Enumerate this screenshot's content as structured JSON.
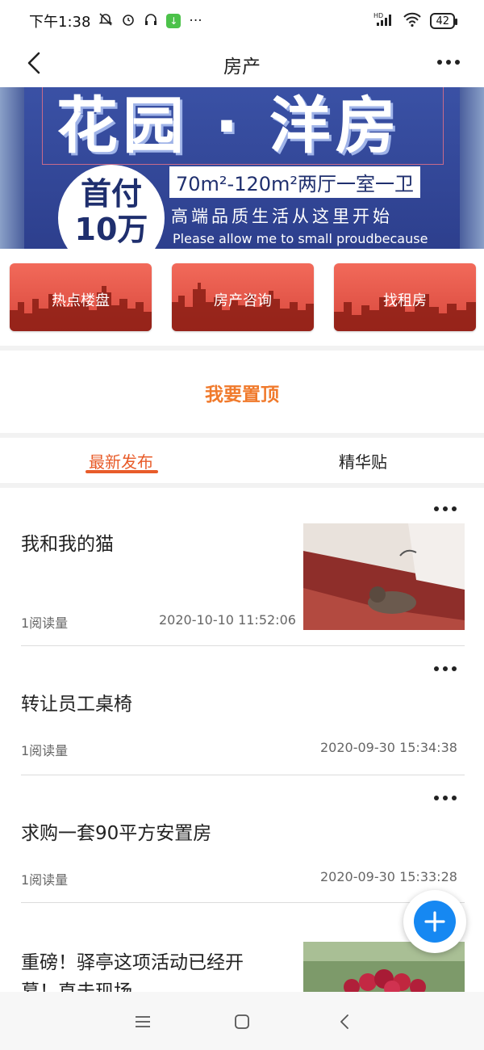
{
  "status_bar": {
    "time": "下午1:38",
    "left_icons": [
      "mute-icon",
      "alarm-icon",
      "headphones-icon",
      "download-icon",
      "more-dots"
    ],
    "right_icons": [
      "hd-signal-icon",
      "wifi-icon",
      "battery-icon"
    ],
    "signal_badge": "HD",
    "battery": "42"
  },
  "nav": {
    "title": "房产",
    "back_icon": "back-arrow-icon",
    "more_icon": "more-icon"
  },
  "banner": {
    "headline": "花园 · 洋房",
    "circle_line1": "首付",
    "circle_line2": "10万",
    "spec": "70m²-120m²两厅一室一卫",
    "tagline": "高端品质生活从这里开始",
    "english": "Please allow me to small proudbecause"
  },
  "categories": [
    {
      "label": "热点楼盘"
    },
    {
      "label": "房产咨询"
    },
    {
      "label": "找租房"
    }
  ],
  "pin": {
    "label": "我要置顶"
  },
  "tabs": [
    {
      "label": "最新发布",
      "active": true
    },
    {
      "label": "精华贴",
      "active": false
    }
  ],
  "posts": [
    {
      "title": "我和我的猫",
      "views": "1阅读量",
      "time": "2020-10-10 11:52:06",
      "has_image": true,
      "image": "cat-photo"
    },
    {
      "title": "转让员工桌椅",
      "views": "1阅读量",
      "time": "2020-09-30 15:34:38",
      "has_image": false
    },
    {
      "title": "求购一套90平方安置房",
      "views": "1阅读量",
      "time": "2020-09-30 15:33:28",
      "has_image": false
    },
    {
      "title_line1": "重磅！驿亭这项活动已经开",
      "title_line2": "幕！直击现场",
      "has_image": true,
      "image": "bayberry-photo"
    }
  ],
  "fab": {
    "icon": "plus-icon",
    "color": "#1688f2"
  },
  "bottom_nav": {
    "icons": [
      "menu-icon",
      "home-square-icon",
      "back-chevron-icon"
    ]
  },
  "colors": {
    "accent": "#e85c2a",
    "pin_orange": "#f07a2c",
    "card_red": "#e0503f",
    "banner_blue": "#2f4a9a"
  }
}
